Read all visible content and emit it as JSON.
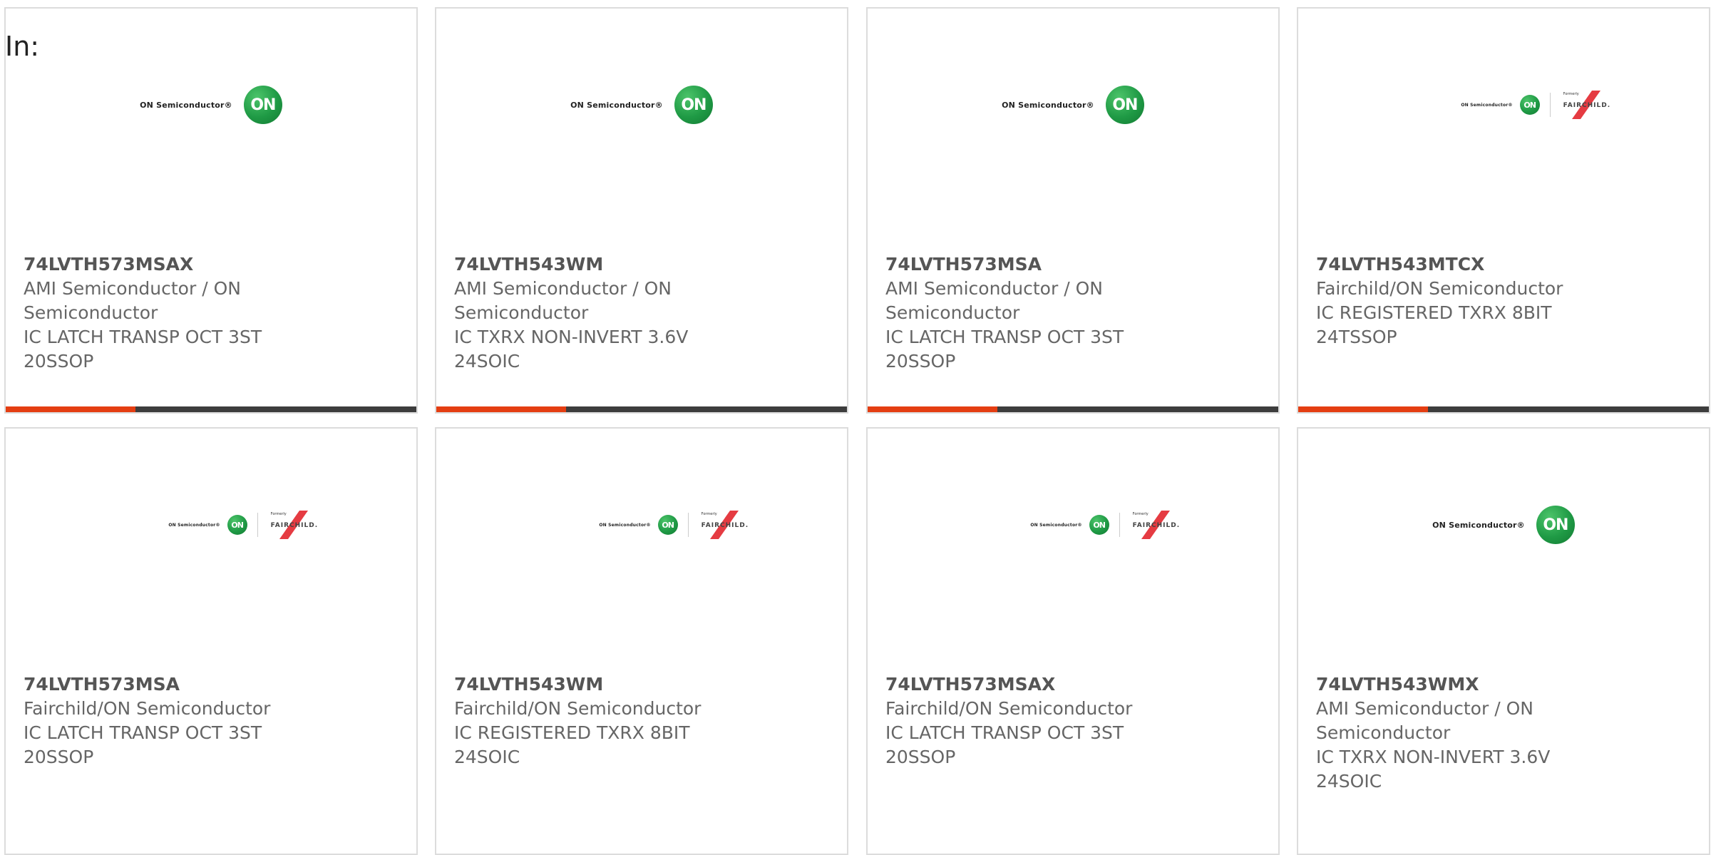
{
  "label": "In:",
  "colors": {
    "accent": "#e43e12",
    "bar": "#3d3d3d",
    "on_green": "#1f9a45",
    "fairchild_red": "#e2262d"
  },
  "logos": {
    "on_text": "ON Semiconductor®",
    "on_mark": "ON",
    "fc_formerly": "Formerly",
    "fc_word": "FAIRCHILD."
  },
  "cards": [
    {
      "part": "74LVTH573MSAX",
      "maker": "AMI Semiconductor / ON Semiconductor",
      "desc": "IC LATCH TRANSP OCT 3ST 20SSOP",
      "logo": "on-semiconductor-logo"
    },
    {
      "part": "74LVTH543WM",
      "maker": "AMI Semiconductor / ON Semiconductor",
      "desc": "IC TXRX NON-INVERT 3.6V 24SOIC",
      "logo": "on-semiconductor-logo"
    },
    {
      "part": "74LVTH573MSA",
      "maker": "AMI Semiconductor / ON Semiconductor",
      "desc": "IC LATCH TRANSP OCT 3ST 20SSOP",
      "logo": "on-semiconductor-logo"
    },
    {
      "part": "74LVTH543MTCX",
      "maker": "Fairchild/ON Semiconductor",
      "desc": "IC REGISTERED TXRX 8BIT 24TSSOP",
      "logo": "on-fairchild-logo"
    },
    {
      "part": "74LVTH573MSA",
      "maker": "Fairchild/ON Semiconductor",
      "desc": "IC LATCH TRANSP OCT 3ST 20SSOP",
      "logo": "on-fairchild-logo"
    },
    {
      "part": "74LVTH543WM",
      "maker": "Fairchild/ON Semiconductor",
      "desc": "IC REGISTERED TXRX 8BIT 24SOIC",
      "logo": "on-fairchild-logo"
    },
    {
      "part": "74LVTH573MSAX",
      "maker": "Fairchild/ON Semiconductor",
      "desc": "IC LATCH TRANSP OCT 3ST 20SSOP",
      "logo": "on-fairchild-logo"
    },
    {
      "part": "74LVTH543WMX",
      "maker": "AMI Semiconductor / ON Semiconductor",
      "desc": "IC TXRX NON-INVERT 3.6V 24SOIC",
      "logo": "on-semiconductor-logo"
    }
  ]
}
